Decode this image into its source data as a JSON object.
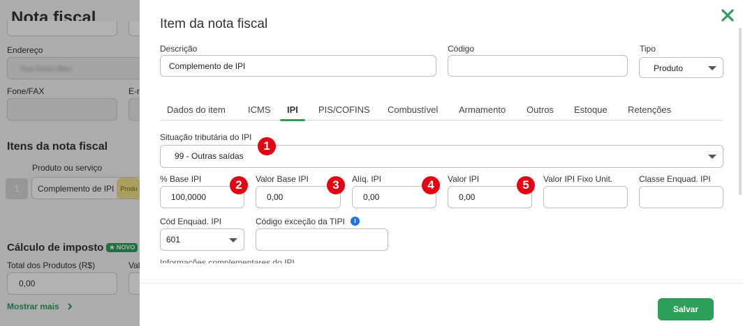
{
  "background": {
    "title": "Nota fiscal",
    "endereco_label": "Endereço",
    "endereco_value": "Rua Otavio Bilac",
    "fone_label": "Fone/FAX",
    "email_label": "E-m",
    "itens_title": "Itens da nota fiscal",
    "produto_label": "Produto ou serviço",
    "item_number": "1",
    "item_name": "Complemento de IPI",
    "item_tag": "Produ",
    "calculo_title": "Cálculo de imposto",
    "novo_badge": "★ NOVO",
    "total_produtos_label": "Total dos Produtos (R$)",
    "val_label": "Val",
    "total_produtos_value": "0,00",
    "mostrar_mais": "Mostrar mais"
  },
  "modal": {
    "title": "Item da nota fiscal",
    "descricao_label": "Descrição",
    "descricao_value": "Complemento de IPI",
    "codigo_label": "Código",
    "codigo_value": "",
    "tipo_label": "Tipo",
    "tipo_value": "Produto",
    "tabs": [
      "Dados do item",
      "ICMS",
      "IPI",
      "PIS/COFINS",
      "Combustível",
      "Armamento",
      "Outros",
      "Estoque",
      "Retenções"
    ],
    "active_tab": "IPI",
    "situacao_label": "Situação tributária do IPI",
    "situacao_value": "99 - Outras saídas",
    "base_ipi_label": "% Base IPI",
    "base_ipi_value": "100,0000",
    "valor_base_ipi_label": "Valor Base IPI",
    "valor_base_ipi_value": "0,00",
    "aliq_ipi_label": "Alíq. IPI",
    "aliq_ipi_value": "0,00",
    "valor_ipi_label": "Valor IPI",
    "valor_ipi_value": "0,00",
    "valor_ipi_fixo_label": "Valor IPI Fixo Unit.",
    "valor_ipi_fixo_value": "",
    "classe_enquad_label": "Classe Enquad. IPI",
    "classe_enquad_value": "",
    "cod_enquad_label": "Cód Enquad. IPI",
    "cod_enquad_value": "601",
    "codigo_excecao_label": "Código exceção da TIPI",
    "codigo_excecao_value": "",
    "info_icon": "i",
    "cut_text": "Informações complementares do IPI",
    "save_label": "Salvar"
  },
  "markers": [
    "1",
    "2",
    "3",
    "4",
    "5"
  ],
  "colors": {
    "accent": "#2e9e5b",
    "marker": "#e60012",
    "info": "#1a73e8"
  }
}
